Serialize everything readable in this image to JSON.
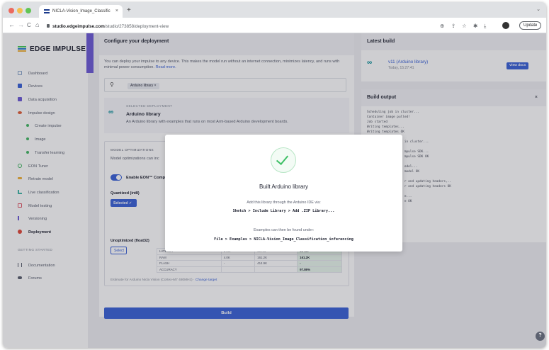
{
  "browser": {
    "tab_title": "NICLA-Vision_Image_Classific",
    "tab_close": "×",
    "new_tab": "+",
    "tab_menu": "⌄",
    "nav_back": "←",
    "nav_forward": "→",
    "nav_reload": "C",
    "nav_home": "⌂",
    "url_host": "studio.edgeimpulse.com",
    "url_path": "/studio/273858/deployment-view",
    "toolbar_icons": [
      "zoom-icon",
      "share-icon",
      "star-icon",
      "extensions-icon",
      "download-icon",
      "sidepanel-icon"
    ],
    "update_label": "Update"
  },
  "sidebar": {
    "logo": "EDGE IMPULSE",
    "items": [
      {
        "label": "Dashboard",
        "icon": "dashboard-icon",
        "color": "#8aa5c9"
      },
      {
        "label": "Devices",
        "icon": "devices-icon",
        "color": "#3b63d8"
      },
      {
        "label": "Data acquisition",
        "icon": "data-acquisition-icon",
        "color": "#6e5cd6"
      },
      {
        "label": "Impulse design",
        "icon": "impulse-design-icon",
        "color": "#e0603a"
      },
      {
        "label": "Create impulse",
        "sub": true
      },
      {
        "label": "Image",
        "sub": true
      },
      {
        "label": "Transfer learning",
        "sub": true
      },
      {
        "label": "EON Tuner",
        "icon": "eon-tuner-icon",
        "color": "#45b865"
      },
      {
        "label": "Retrain model",
        "icon": "retrain-icon",
        "color": "#f0b33b"
      },
      {
        "label": "Live classification",
        "icon": "live-classification-icon",
        "color": "#45b8a8"
      },
      {
        "label": "Model testing",
        "icon": "model-testing-icon",
        "color": "#e05a6a"
      },
      {
        "label": "Versioning",
        "icon": "versioning-icon",
        "color": "#6e5cd6"
      },
      {
        "label": "Deployment",
        "icon": "deployment-icon",
        "color": "#e04a3a"
      }
    ],
    "getting_started_label": "GETTING STARTED",
    "footer_items": [
      {
        "label": "Documentation",
        "icon": "documentation-icon"
      },
      {
        "label": "Forums",
        "icon": "forums-icon"
      }
    ]
  },
  "deploy": {
    "title": "Configure your deployment",
    "desc": "You can deploy your impulse to any device. This makes the model run without an internet connection, minimizes latency, and runs with minimal power consumption.",
    "read_more": "Read more.",
    "search_chip": "Arduino library  ×",
    "selected_label": "SELECTED DEPLOYMENT",
    "selected_title": "Arduino library",
    "selected_desc": "An Arduino library with examples that runs on most Arm-based Arduino development boards.",
    "opt_label": "MODEL OPTIMIZATIONS",
    "opt_desc": "Model optimizations can inc",
    "eon_label": "Enable EON™ Comp",
    "quant_label": "Quantized (int8)",
    "selected_btn": "Selected ✓",
    "unopt_label": "Unoptimized (float32)",
    "select_btn": "Select",
    "table_rows": [
      [
        "LATENCY",
        "1 ms",
        "49 ms",
        "50 ms"
      ],
      [
        "RAM",
        "4.0K",
        "161.2K",
        "161.2K"
      ],
      [
        "FLASH",
        "-",
        "414.9K",
        "-"
      ],
      [
        "ACCURACY",
        "",
        "",
        "97.86%"
      ]
    ],
    "estimate": "Estimate for Arduino Nicla Vision (Cortex-M7 480MHz) ·",
    "change_target": "Change target",
    "build_btn": "Build"
  },
  "latest_build": {
    "title": "Latest build",
    "item_title": "v11 (Arduino library)",
    "item_time": "Today, 15:27:41",
    "view_docs": "View docs"
  },
  "build_output": {
    "title": "Build output",
    "close": "×",
    "log": "Scheduling job in cluster...\nContainer image pulled!\nJob started\nWriting templates...\nWriting templates OK\n\n                    in cluster...\n\n                    mpulse SDK...\n                    mpulse SDK OK\n\n                    odel...\n                    model OK\n\n                    r and updating headers,..\n                    r and updating headers OK\n\n                    e...\n                    e OK"
  },
  "modal": {
    "title": "Built Arduino library",
    "line1": "Add this library through the Arduino IDE via:",
    "code1": "Sketch > Include Library > Add .ZIP Library...",
    "line2": "Examples can then be found under:",
    "code2": "File > Examples > NICLA-Vision_Image_Classification_inferencing"
  },
  "help": "?"
}
